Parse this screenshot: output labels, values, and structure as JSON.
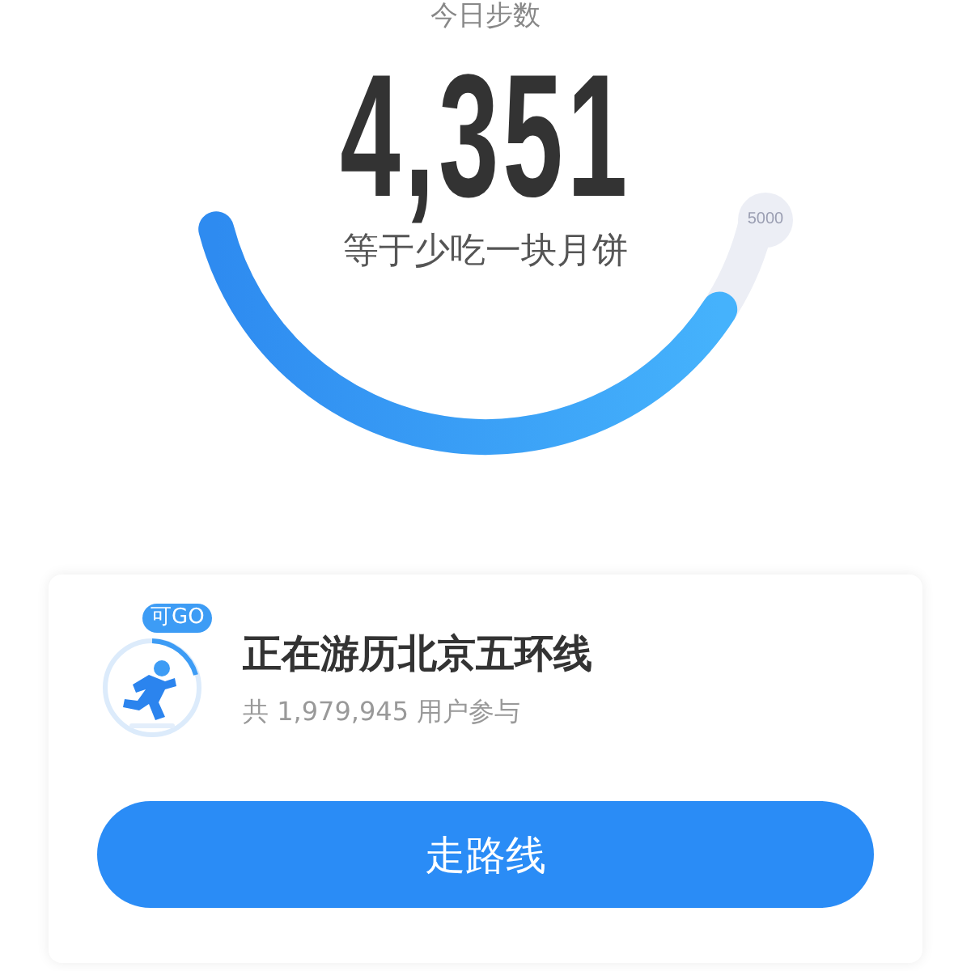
{
  "header": {
    "label": "今日步数"
  },
  "steps": {
    "count": "4,351",
    "comparison": "等于少吃一块月饼",
    "goal": "5000"
  },
  "card": {
    "badge": "可GO",
    "title": "正在游历北京五环线",
    "participants": "共 1,979,945 用户参与",
    "button": "走路线"
  }
}
